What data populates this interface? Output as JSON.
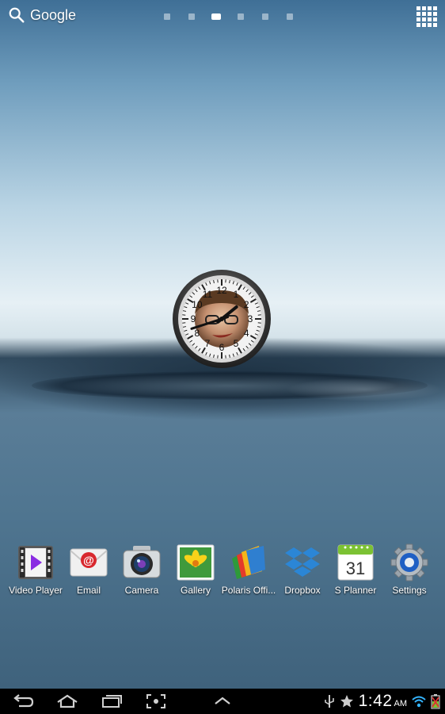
{
  "top_bar": {
    "search_label": "Google",
    "page_count": 6,
    "active_page": 3
  },
  "clock_widget": {
    "numbers": [
      "12",
      "1",
      "2",
      "3",
      "4",
      "5",
      "6",
      "7",
      "8",
      "9",
      "10",
      "11"
    ],
    "hour": 1,
    "minute": 42
  },
  "dock": {
    "apps": [
      {
        "label": "Video Player",
        "icon": "video-player-icon"
      },
      {
        "label": "Email",
        "icon": "email-icon"
      },
      {
        "label": "Camera",
        "icon": "camera-icon"
      },
      {
        "label": "Gallery",
        "icon": "gallery-icon"
      },
      {
        "label": "Polaris Offi...",
        "icon": "polaris-office-icon"
      },
      {
        "label": "Dropbox",
        "icon": "dropbox-icon"
      },
      {
        "label": "S Planner",
        "icon": "s-planner-icon"
      },
      {
        "label": "Settings",
        "icon": "settings-icon"
      }
    ],
    "planner_date": "31"
  },
  "status_bar": {
    "time": "1:42",
    "ampm": "AM"
  }
}
